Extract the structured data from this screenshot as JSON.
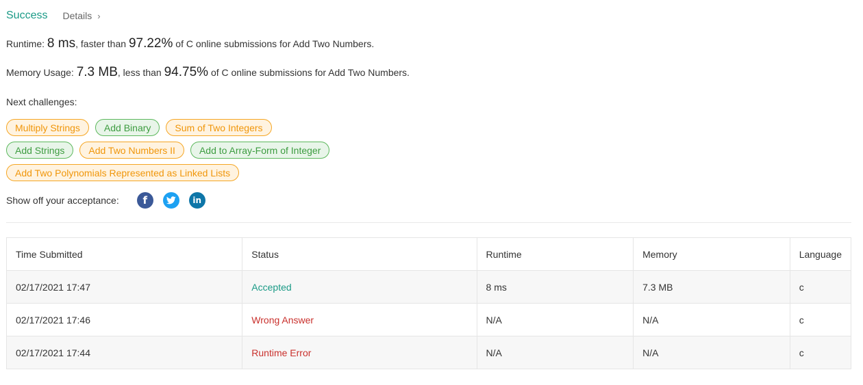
{
  "result": {
    "status": "Success",
    "details_label": "Details",
    "details_chevron": "›"
  },
  "runtime": {
    "prefix": "Runtime: ",
    "value": "8 ms",
    "middle": ", faster than ",
    "percent": "97.22%",
    "suffix": " of C online submissions for Add Two Numbers."
  },
  "memory": {
    "prefix": "Memory Usage: ",
    "value": "7.3 MB",
    "middle": ", less than ",
    "percent": "94.75%",
    "suffix": " of C online submissions for Add Two Numbers."
  },
  "next_challenges": {
    "label": "Next challenges:",
    "rows": [
      [
        {
          "label": "Multiply Strings",
          "color": "orange"
        },
        {
          "label": "Add Binary",
          "color": "green"
        },
        {
          "label": "Sum of Two Integers",
          "color": "orange"
        }
      ],
      [
        {
          "label": "Add Strings",
          "color": "green"
        },
        {
          "label": "Add Two Numbers II",
          "color": "orange"
        },
        {
          "label": "Add to Array-Form of Integer",
          "color": "green"
        }
      ],
      [
        {
          "label": "Add Two Polynomials Represented as Linked Lists",
          "color": "orange"
        }
      ]
    ]
  },
  "share": {
    "label": "Show off your acceptance:",
    "icons": [
      {
        "name": "facebook-icon",
        "glyph": "f"
      },
      {
        "name": "twitter-icon",
        "glyph": ""
      },
      {
        "name": "linkedin-icon",
        "glyph": "in"
      }
    ]
  },
  "submissions": {
    "headers": [
      "Time Submitted",
      "Status",
      "Runtime",
      "Memory",
      "Language"
    ],
    "rows": [
      {
        "time": "02/17/2021 17:47",
        "status": "Accepted",
        "status_kind": "accepted",
        "runtime": "8 ms",
        "memory": "7.3 MB",
        "language": "c"
      },
      {
        "time": "02/17/2021 17:46",
        "status": "Wrong Answer",
        "status_kind": "wrong",
        "runtime": "N/A",
        "memory": "N/A",
        "language": "c"
      },
      {
        "time": "02/17/2021 17:44",
        "status": "Runtime Error",
        "status_kind": "error",
        "runtime": "N/A",
        "memory": "N/A",
        "language": "c"
      }
    ]
  },
  "colors": {
    "success": "#1a9a86",
    "error": "#c9302c",
    "tag_orange": "#f5a623",
    "tag_green": "#5cb85c",
    "facebook": "#3b5998",
    "twitter": "#1da1f2",
    "linkedin": "#0e76a8"
  }
}
